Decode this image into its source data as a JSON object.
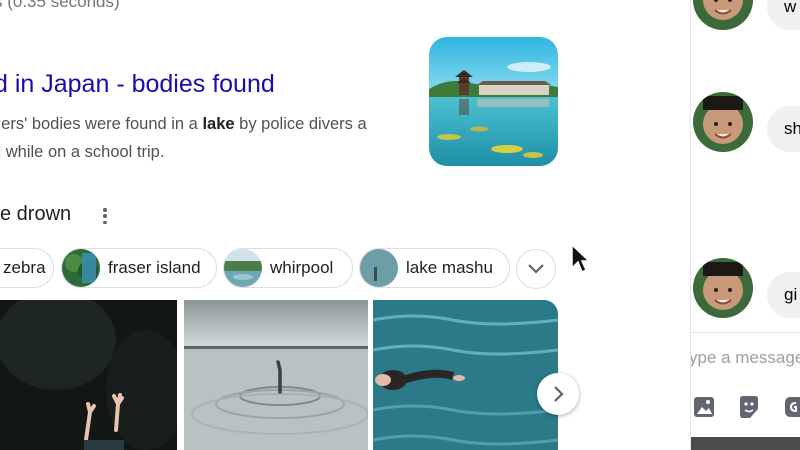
{
  "search": {
    "result_stats": "s (0.35 seconds)",
    "result_title": "d in Japan - bodies found",
    "snippet_line1_pre": "gers' bodies were found in a ",
    "snippet_bold": "lake",
    "snippet_line1_post": " by police divers a",
    "snippet_line2": "d while on a school trip.",
    "thumb_icon": "lake-pagoda-thumbnail"
  },
  "related": {
    "heading": "ke drown",
    "menu_icon": "more-vert-icon",
    "chips": [
      {
        "label": "zebra"
      },
      {
        "label": "fraser island"
      },
      {
        "label": "whirpool"
      },
      {
        "label": "lake mashu"
      }
    ],
    "more_icon": "chevron-down-icon",
    "next_icon": "chevron-right-icon"
  },
  "chat": {
    "bubbles": [
      {
        "text": "w"
      },
      {
        "text": "sh"
      },
      {
        "text": "gi"
      }
    ],
    "composer_placeholder": "ype a message",
    "icons": [
      "image-icon",
      "sticker-icon",
      "gif-icon"
    ]
  },
  "colors": {
    "link": "#1a0dab",
    "chip_border": "#dadce0",
    "bubble_bg": "#f0f0f0"
  }
}
